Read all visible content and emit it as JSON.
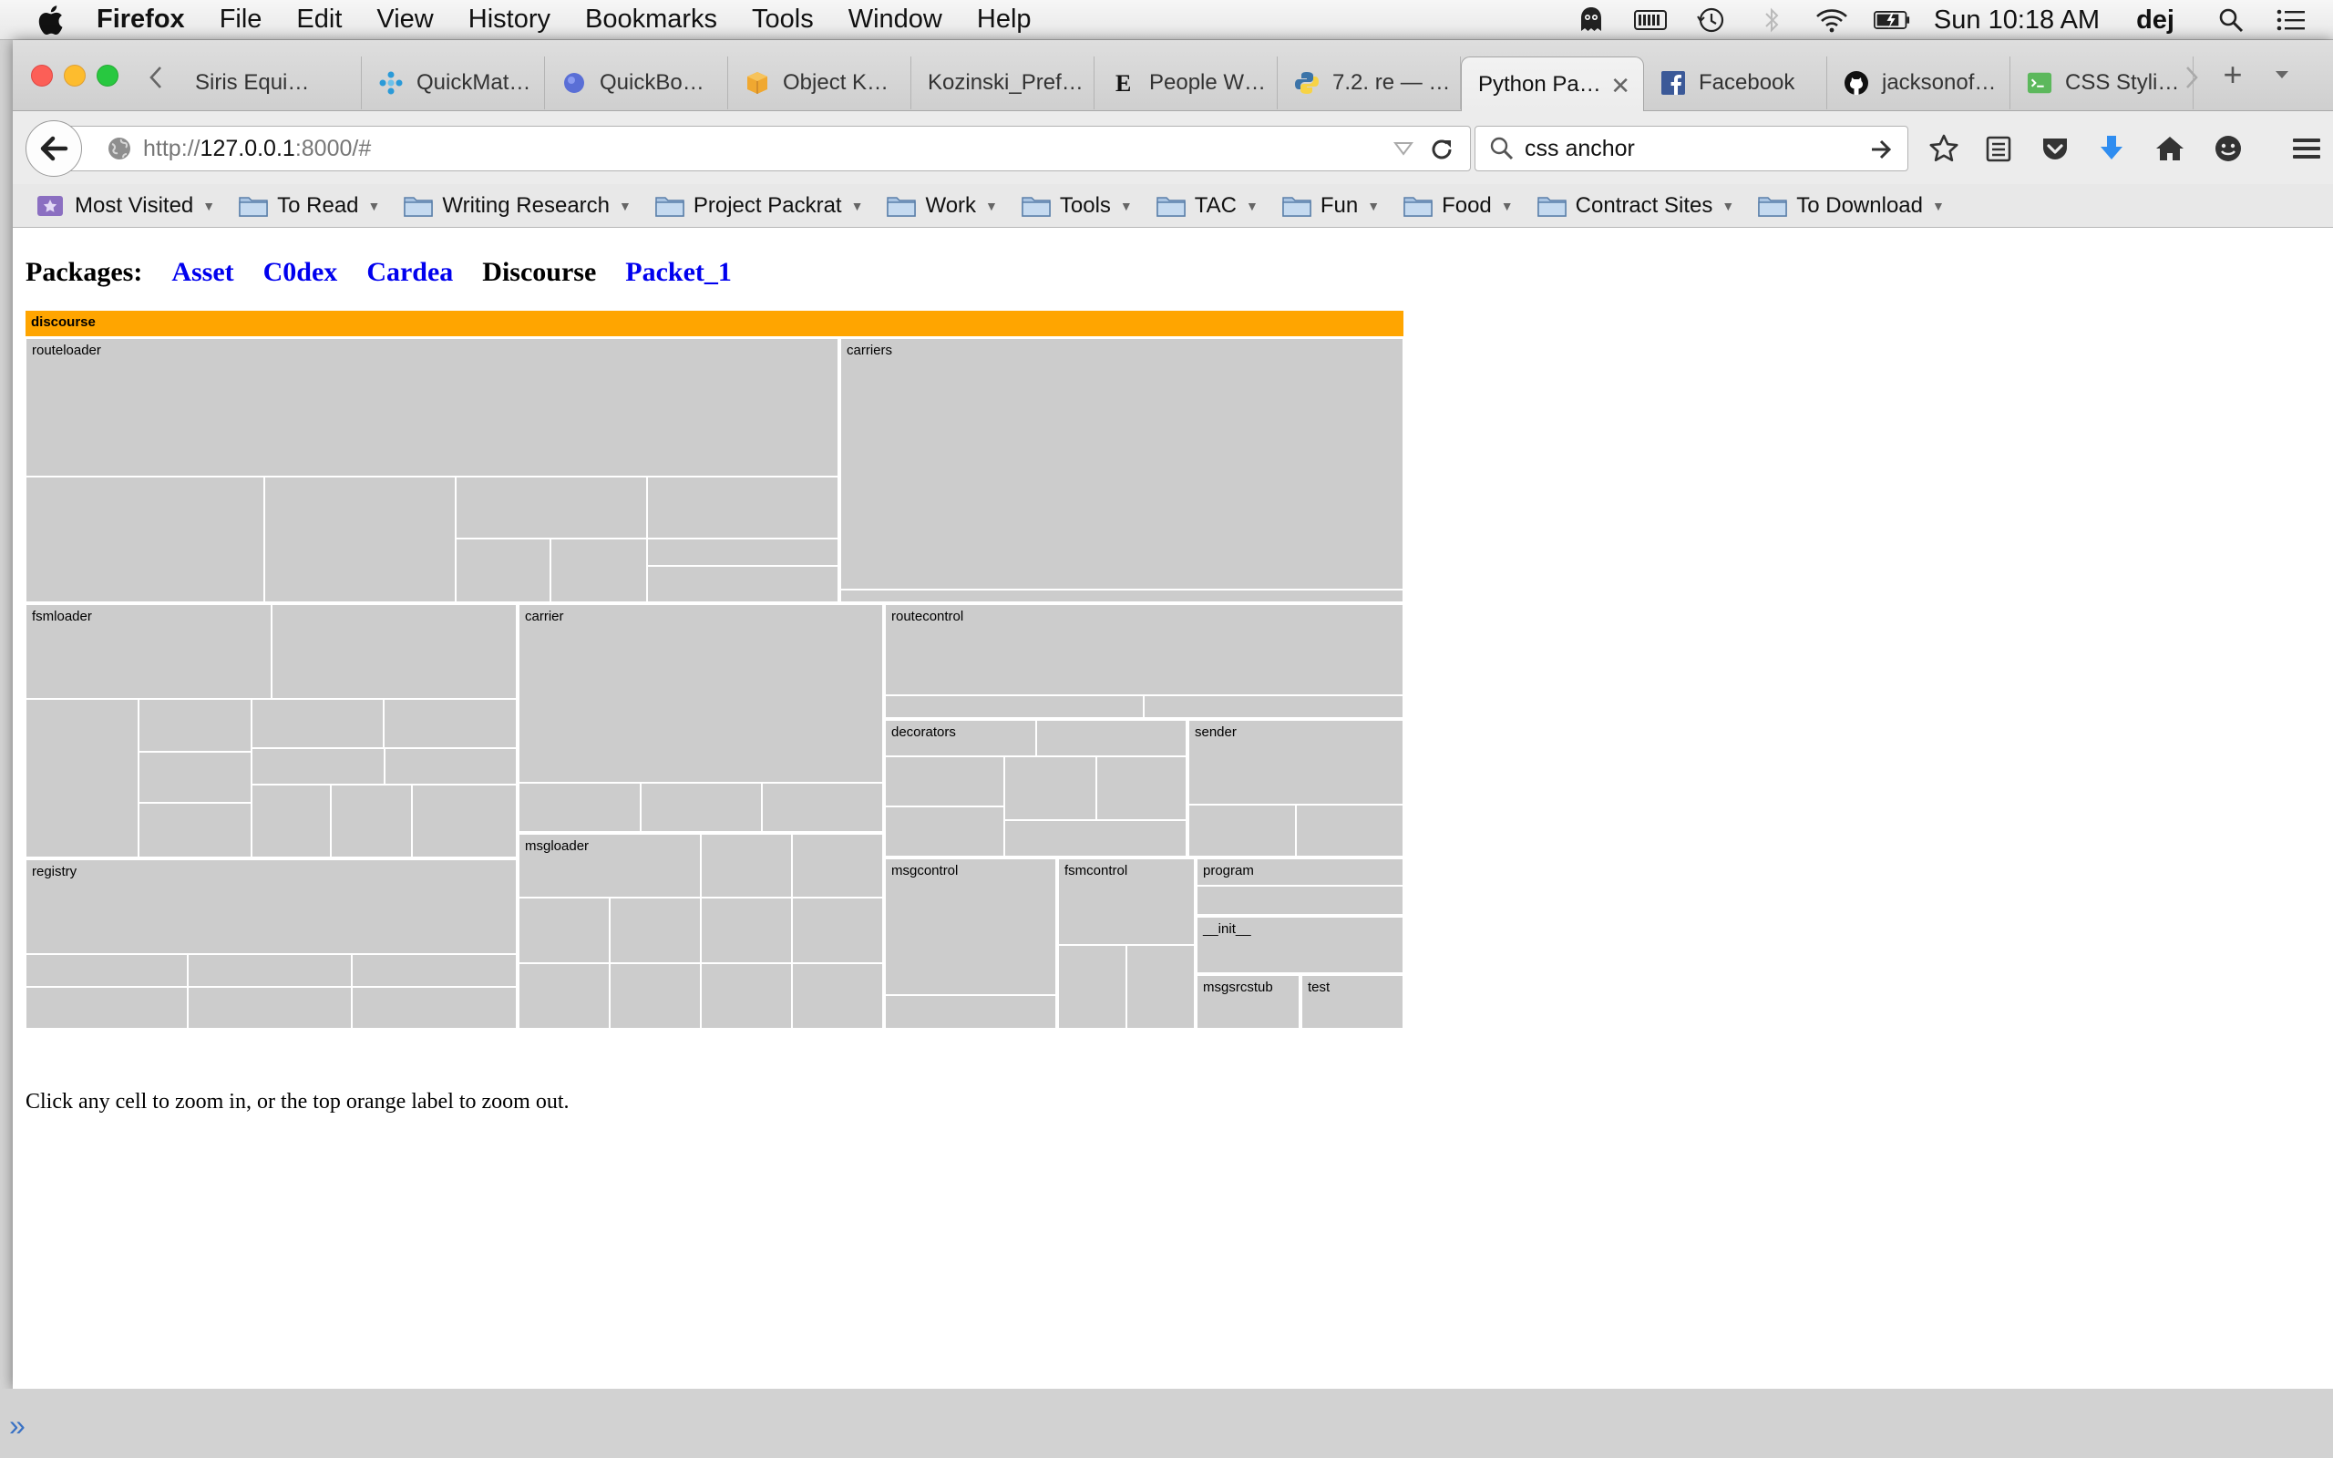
{
  "menubar": {
    "app_name": "Firefox",
    "items": [
      "File",
      "Edit",
      "View",
      "History",
      "Bookmarks",
      "Tools",
      "Window",
      "Help"
    ],
    "clock": "Sun 10:18 AM",
    "user": "dej",
    "status_icons": [
      "ghost-icon",
      "battery-meter-icon",
      "time-machine-icon",
      "bluetooth-icon",
      "wifi-icon",
      "battery-icon",
      "spotlight-search-icon",
      "notification-center-icon"
    ]
  },
  "tabs": [
    {
      "title": "Siris Equi…",
      "icon": "none"
    },
    {
      "title": "QuickMat…",
      "icon": "quickmat-icon",
      "color": "#2a9ad8"
    },
    {
      "title": "QuickBo…",
      "icon": "quickbooks-icon",
      "color": "#5a6fd6"
    },
    {
      "title": "Object K…",
      "icon": "aws-box-icon",
      "color": "#f0a830"
    },
    {
      "title": "Kozinski_Pref…",
      "icon": "none"
    },
    {
      "title": "People W…",
      "icon": "esquire-e-icon"
    },
    {
      "title": "7.2. re — …",
      "icon": "python-icon"
    },
    {
      "title": "Python Pa…",
      "icon": "none",
      "active": true
    },
    {
      "title": "Facebook",
      "icon": "facebook-icon",
      "color": "#3b5998"
    },
    {
      "title": "jacksonof…",
      "icon": "github-icon"
    },
    {
      "title": "CSS Styli…",
      "icon": "css-icon",
      "color": "#5cb85c"
    }
  ],
  "nav": {
    "url_prefix": "http://",
    "url_host": "127.0.0.1",
    "url_rest": ":8000/#",
    "search_value": "css anchor"
  },
  "bookmarks": [
    "Most Visited",
    "To Read",
    "Writing Research",
    "Project Packrat",
    "Work",
    "Tools",
    "TAC",
    "Fun",
    "Food",
    "Contract Sites",
    "To Download"
  ],
  "page": {
    "packages_label": "Packages:",
    "packages": [
      {
        "name": "Asset",
        "link": true
      },
      {
        "name": "C0dex",
        "link": true
      },
      {
        "name": "Cardea",
        "link": true
      },
      {
        "name": "Discourse",
        "link": false
      },
      {
        "name": "Packet_1",
        "link": true
      }
    ],
    "treemap_root": "discourse",
    "hint": "Click any cell to zoom in, or the top orange label to zoom out.",
    "cell_color": "#cccccc",
    "header_color": "#ffa500"
  },
  "treemap_groups": [
    {
      "name": "routeloader",
      "label": "routeloader"
    },
    {
      "name": "carriers",
      "label": "carriers"
    },
    {
      "name": "fsmloader",
      "label": "fsmloader"
    },
    {
      "name": "carrier",
      "label": "carrier"
    },
    {
      "name": "routecontrol",
      "label": "routecontrol"
    },
    {
      "name": "decorators",
      "label": "decorators"
    },
    {
      "name": "sender",
      "label": "sender"
    },
    {
      "name": "registry",
      "label": "registry"
    },
    {
      "name": "msgloader",
      "label": "msgloader"
    },
    {
      "name": "msgcontrol",
      "label": "msgcontrol"
    },
    {
      "name": "fsmcontrol",
      "label": "fsmcontrol"
    },
    {
      "name": "program",
      "label": "program"
    },
    {
      "name": "init",
      "label": "__init__"
    },
    {
      "name": "msgsrcstub",
      "label": "msgsrcstub"
    },
    {
      "name": "test",
      "label": "test"
    }
  ]
}
